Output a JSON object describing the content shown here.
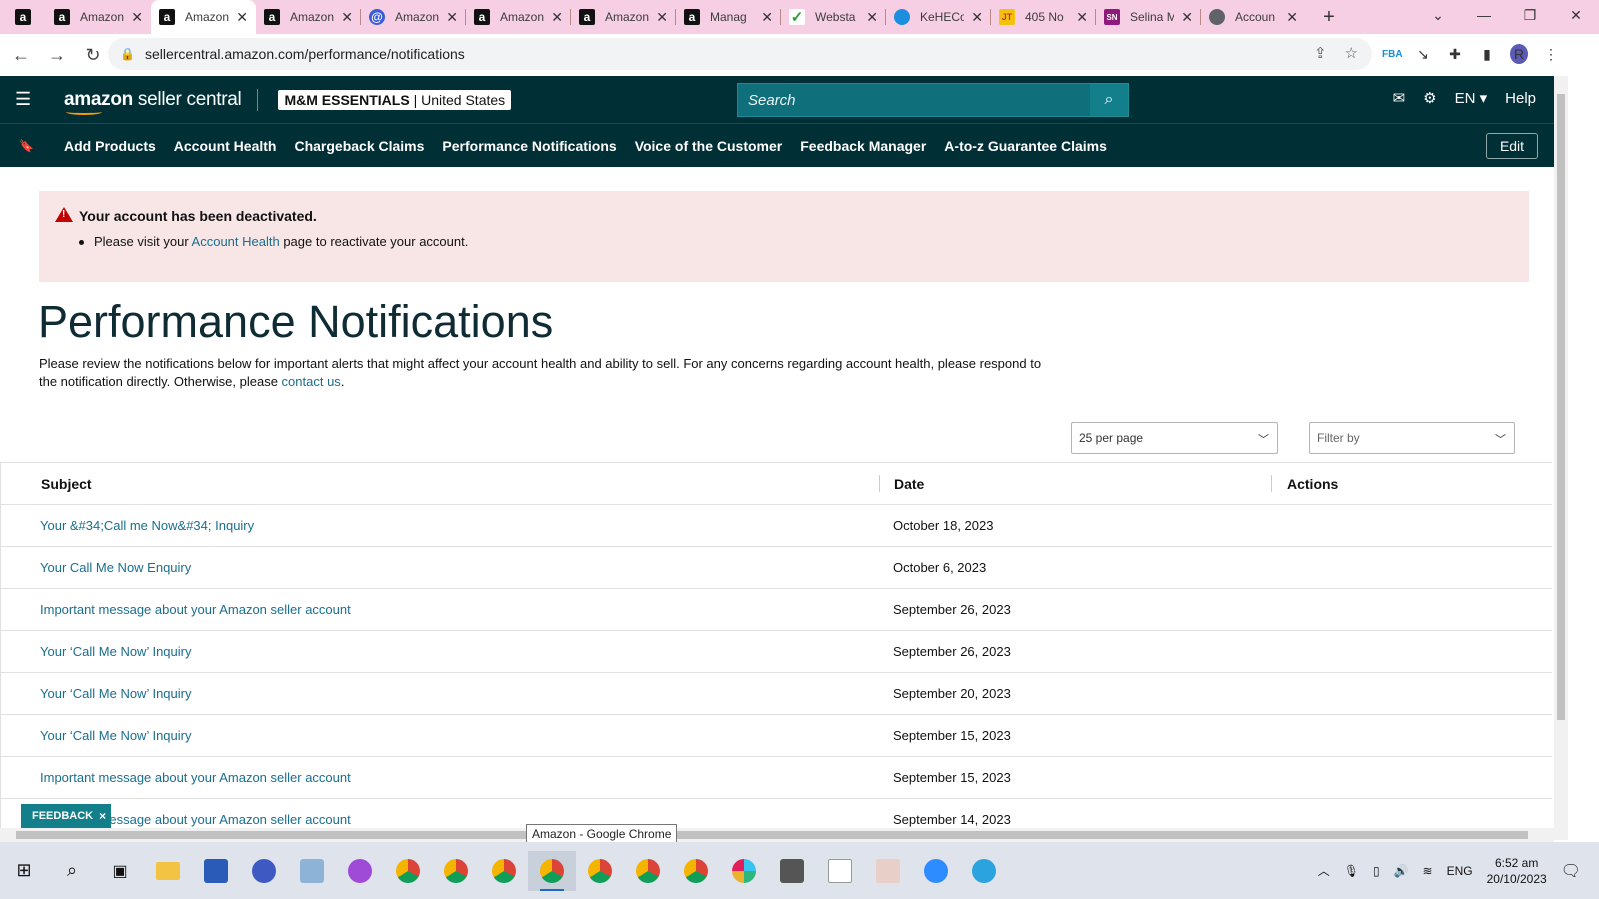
{
  "browser": {
    "tabs": [
      {
        "icon": "amazon-icon",
        "title": ""
      },
      {
        "icon": "amazon-icon",
        "title": "Amazon"
      },
      {
        "icon": "amazon-icon",
        "title": "Amazon"
      },
      {
        "icon": "amazon-icon",
        "title": "Amazon"
      },
      {
        "icon": "circle-icon",
        "title": "Amazon"
      },
      {
        "icon": "amazon-icon",
        "title": "Amazon"
      },
      {
        "icon": "amazon-icon",
        "title": "Amazon"
      },
      {
        "icon": "amazon-icon",
        "title": "Manag"
      },
      {
        "icon": "green-check-icon",
        "title": "Websta"
      },
      {
        "icon": "edge-icon",
        "title": "KeHECo"
      },
      {
        "icon": "yellow-icon",
        "title": "405 No"
      },
      {
        "icon": "sn-icon",
        "title": "Selina M"
      },
      {
        "icon": "globe-icon",
        "title": "Accoun"
      }
    ],
    "url": "sellercentral.amazon.com/performance/notifications",
    "profile_initial": "R"
  },
  "header": {
    "logo_main": "amazon",
    "logo_suffix": " seller central",
    "merchant_name": "M&M ESSENTIALS",
    "merchant_sep": " | ",
    "merchant_region": "United States",
    "search_placeholder": "Search",
    "language": "EN",
    "help": "Help"
  },
  "nav": {
    "items": [
      "Add Products",
      "Account Health",
      "Chargeback Claims",
      "Performance Notifications",
      "Voice of the Customer",
      "Feedback Manager",
      "A-to-z Guarantee Claims"
    ],
    "edit": "Edit"
  },
  "alert": {
    "title": "Your account has been deactivated.",
    "line_pre": "Please visit your ",
    "line_link": "Account Health",
    "line_post": " page to reactivate your account."
  },
  "page": {
    "title": "Performance Notifications",
    "desc_pre": "Please review the notifications below for important alerts that might affect your account health and ability to sell. For any concerns regarding account health, please respond to the notification directly. Otherwise, please ",
    "desc_link": "contact us",
    "desc_post": "."
  },
  "filters": {
    "per_page": "25 per page",
    "filter_placeholder": "Filter by"
  },
  "table": {
    "headers": {
      "subject": "Subject",
      "date": "Date",
      "actions": "Actions"
    },
    "rows": [
      {
        "subject": "Your &#34;Call me Now&#34; Inquiry",
        "date": "October 18, 2023"
      },
      {
        "subject": "Your Call Me Now Enquiry",
        "date": "October 6, 2023"
      },
      {
        "subject": "Important message about your Amazon seller account",
        "date": "September 26, 2023"
      },
      {
        "subject": "Your ‘Call Me Now’ Inquiry",
        "date": "September 26, 2023"
      },
      {
        "subject": "Your ‘Call Me Now’ Inquiry",
        "date": "September 20, 2023"
      },
      {
        "subject": "Your ‘Call Me Now’ Inquiry",
        "date": "September 15, 2023"
      },
      {
        "subject": "Important message about your Amazon seller account",
        "date": "September 15, 2023"
      },
      {
        "subject": "Important message about your Amazon seller account",
        "date": "September 14, 2023"
      }
    ]
  },
  "feedback": {
    "label": "FEEDBACK",
    "close": "×"
  },
  "tooltip": "Amazon - Google Chrome",
  "taskbar": {
    "lang": "ENG",
    "time": "6:52 am",
    "date": "20/10/2023"
  }
}
